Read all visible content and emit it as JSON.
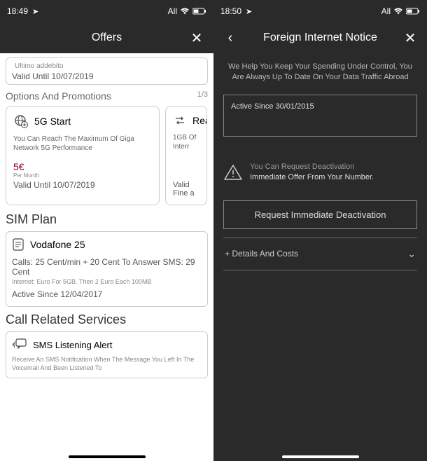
{
  "left": {
    "status": {
      "time": "18:49",
      "network": "All"
    },
    "header": {
      "title": "Offers"
    },
    "lastCharge": {
      "label": "Ultimo addebito",
      "valid": "Valid Until 10/07/2019"
    },
    "options": {
      "title": "Options And Promotions",
      "page": "1/3"
    },
    "promo1": {
      "title": "5G Start",
      "desc": "You Can Reach The Maximum Of Giga Network 5G Performance",
      "price": "5€",
      "period": "Per Month",
      "valid": "Valid Until 10/07/2019"
    },
    "promo2": {
      "title": "Rea",
      "desc": "1GB Of Interr",
      "valid": "Valid Fine a"
    },
    "simSection": "SIM Plan",
    "sim": {
      "title": "Vodafone 25",
      "line1": "Calls: 25 Cent/min + 20 Cent To Answer SMS: 29 Cent",
      "line2": "Internet: Euro For 5GB. Then 2 Euro Each 100MB",
      "active": "Active Since 12/04/2017"
    },
    "servicesSection": "Call Related Services",
    "service": {
      "title": "SMS Listening Alert",
      "desc": "Receive An SMS Notification When The Message You Left In The Voicemail And Been Listened To"
    }
  },
  "right": {
    "status": {
      "time": "18:50",
      "network": "All"
    },
    "header": {
      "title": "Foreign Internet Notice"
    },
    "intro": "We Help You Keep Your Spending Under Control, You Are Always Up To Date On Your Data Traffic Abroad",
    "activeBox": "Active Since 30/01/2015",
    "warn": {
      "line1": "You Can Request Deactivation",
      "line2": "Immediate Offer From Your Number."
    },
    "deactBtn": "Request Immediate Deactivation",
    "details": "+ Details And Costs"
  }
}
